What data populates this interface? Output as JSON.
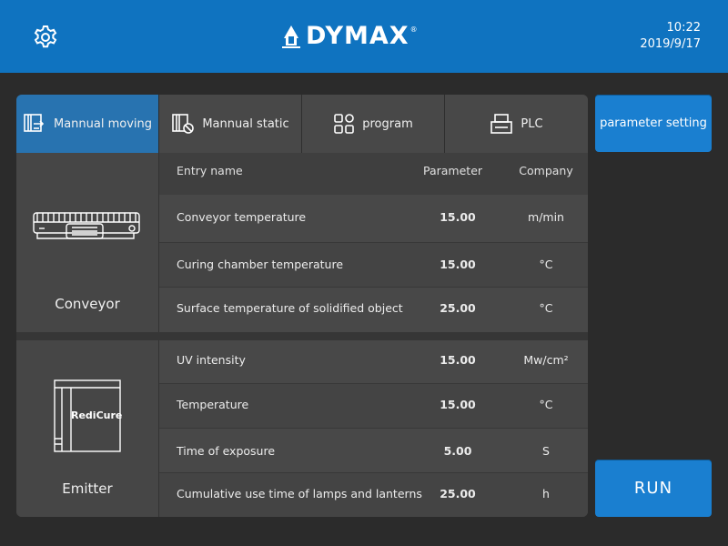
{
  "header": {
    "brand": "DYMAX",
    "brand_mark": "®",
    "time": "10:22",
    "date": "2019/9/17",
    "background": "#0f73c0"
  },
  "tabs": [
    {
      "label": "Mannual moving",
      "icon": "manual-moving-icon",
      "active": true
    },
    {
      "label": "Mannual static",
      "icon": "manual-static-icon",
      "active": false
    },
    {
      "label": "program",
      "icon": "program-grid-icon",
      "active": false
    },
    {
      "label": "PLC",
      "icon": "plc-icon",
      "active": false
    }
  ],
  "table": {
    "columns": {
      "name": "Entry name",
      "parameter": "Parameter",
      "unit": "Company"
    }
  },
  "conveyor": {
    "label": "Conveyor",
    "rows": [
      {
        "name": "Conveyor temperature",
        "value": "15.00",
        "unit": "m/min"
      },
      {
        "name": "Curing chamber temperature",
        "value": "15.00",
        "unit": "°C"
      },
      {
        "name": "Surface temperature of solidified object",
        "value": "25.00",
        "unit": "°C"
      }
    ]
  },
  "emitter": {
    "label": "Emitter",
    "device_text": "RediCure",
    "rows": [
      {
        "name": "UV intensity",
        "value": "15.00",
        "unit": "Mw/cm²"
      },
      {
        "name": "Temperature",
        "value": "15.00",
        "unit": "°C"
      },
      {
        "name": "Time of exposure",
        "value": "5.00",
        "unit": "S"
      },
      {
        "name": "Cumulative use time of lamps and lanterns",
        "value": "25.00",
        "unit": "h"
      }
    ]
  },
  "buttons": {
    "parameter_setting": "parameter setting",
    "run": "RUN"
  },
  "colors": {
    "accent": "#1a7fd0",
    "active_tab": "#2873b0",
    "panel": "#464646",
    "background": "#2b2b2b"
  }
}
